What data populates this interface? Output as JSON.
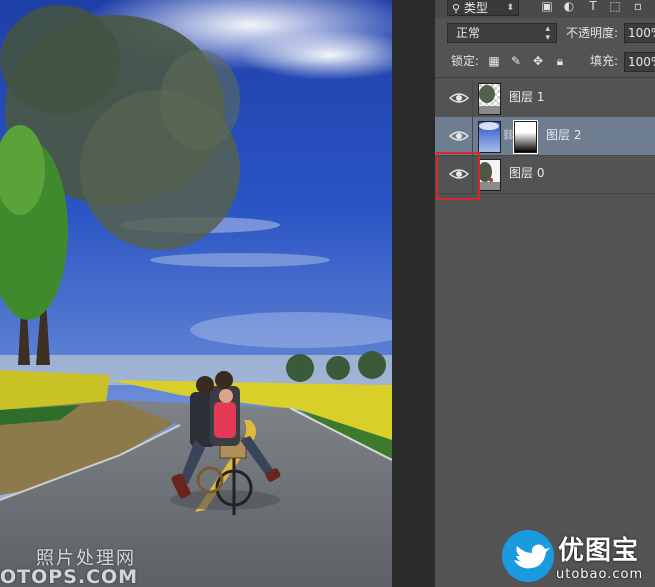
{
  "canvas": {
    "watermark_cn": "照片处理网",
    "watermark_en": "OTOPS.COM"
  },
  "panel": {
    "filter": {
      "label": "类型",
      "icons": [
        "image-filter-icon",
        "adjustment-filter-icon",
        "type-filter-icon",
        "shape-filter-icon",
        "smart-object-filter-icon"
      ]
    },
    "blend_mode": "正常",
    "opacity_label": "不透明度:",
    "opacity_value": "100%",
    "lock_label": "锁定:",
    "lock_icons": [
      "lock-transparent-icon",
      "lock-image-icon",
      "lock-position-icon",
      "lock-all-icon"
    ],
    "fill_label": "填充:",
    "fill_value": "100%",
    "layers": [
      {
        "name": "图层 1",
        "visible": true,
        "selected": false,
        "has_mask": false
      },
      {
        "name": "图层 2",
        "visible": true,
        "selected": true,
        "has_mask": true
      },
      {
        "name": "图层 0",
        "visible": true,
        "selected": false,
        "has_mask": false
      }
    ]
  },
  "highlight_color": "#d9262a",
  "logo": {
    "cn": "优图宝",
    "en": "utobao.com"
  }
}
